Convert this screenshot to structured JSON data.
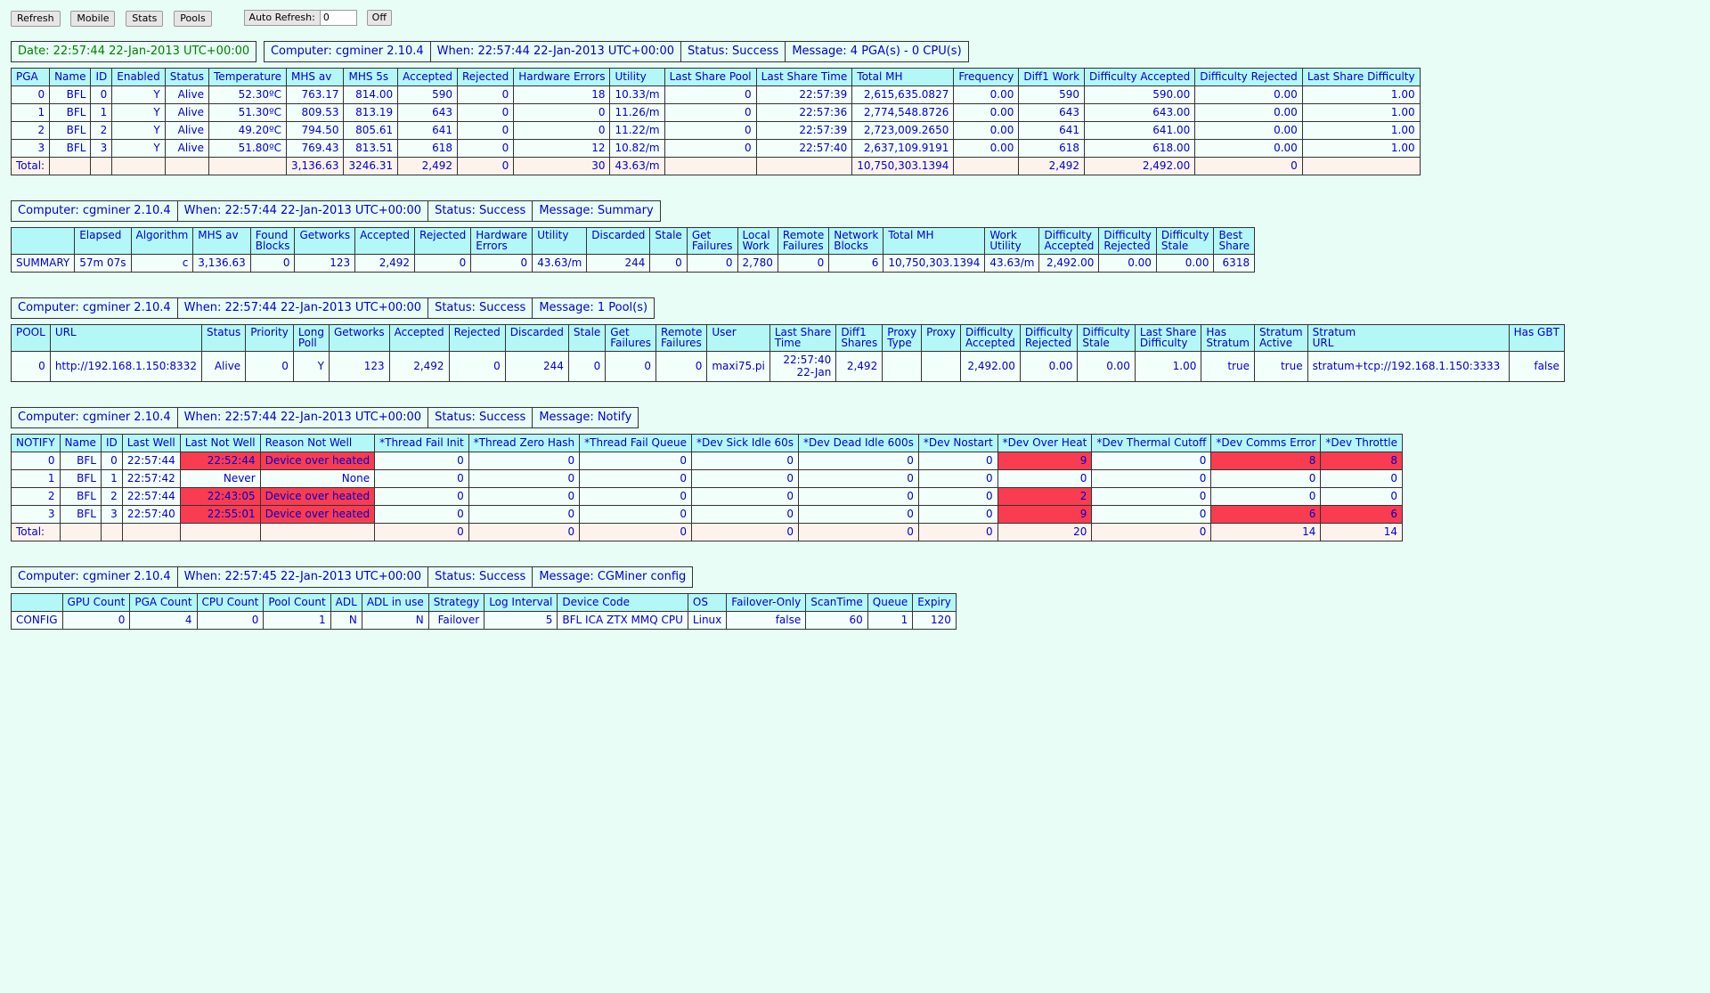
{
  "toolbar": {
    "refresh_label": "Refresh",
    "mobile_label": "Mobile",
    "stats_label": "Stats",
    "pools_label": "Pools",
    "auto_refresh_label": "Auto Refresh:",
    "auto_refresh_value": "0",
    "off_label": "Off"
  },
  "date_line": "Date: 22:57:44 22-Jan-2013 UTC+00:00",
  "colors": {
    "page_bg": "#e8fdf5",
    "header_bg": "#b4f7f7",
    "cell_bg": "#f3fffb",
    "total_bg": "#fdf3ec",
    "error_bg": "#fa3c50",
    "text": "#0000cc",
    "date_text": "#008000",
    "border": "#333333"
  },
  "sections": {
    "pga": {
      "computer": "Computer: cgminer 2.10.4",
      "when": "When: 22:57:44 22-Jan-2013 UTC+00:00",
      "status": "Status: Success",
      "message": "Message: 4 PGA(s) - 0 CPU(s)",
      "headers": [
        "PGA",
        "Name",
        "ID",
        "Enabled",
        "Status",
        "Temperature",
        "MHS av",
        "MHS 5s",
        "Accepted",
        "Rejected",
        "Hardware Errors",
        "Utility",
        "Last Share Pool",
        "Last Share Time",
        "Total MH",
        "Frequency",
        "Diff1 Work",
        "Difficulty Accepted",
        "Difficulty Rejected",
        "Last Share Difficulty"
      ],
      "rows": [
        [
          "0",
          "BFL",
          "0",
          "Y",
          "Alive",
          "52.30ºC",
          "763.17",
          "814.00",
          "590",
          "0",
          "18",
          "10.33/m",
          "0",
          "22:57:39",
          "2,615,635.0827",
          "0.00",
          "590",
          "590.00",
          "0.00",
          "1.00"
        ],
        [
          "1",
          "BFL",
          "1",
          "Y",
          "Alive",
          "51.30ºC",
          "809.53",
          "813.19",
          "643",
          "0",
          "0",
          "11.26/m",
          "0",
          "22:57:36",
          "2,774,548.8726",
          "0.00",
          "643",
          "643.00",
          "0.00",
          "1.00"
        ],
        [
          "2",
          "BFL",
          "2",
          "Y",
          "Alive",
          "49.20ºC",
          "794.50",
          "805.61",
          "641",
          "0",
          "0",
          "11.22/m",
          "0",
          "22:57:39",
          "2,723,009.2650",
          "0.00",
          "641",
          "641.00",
          "0.00",
          "1.00"
        ],
        [
          "3",
          "BFL",
          "3",
          "Y",
          "Alive",
          "51.80ºC",
          "769.43",
          "813.51",
          "618",
          "0",
          "12",
          "10.82/m",
          "0",
          "22:57:40",
          "2,637,109.9191",
          "0.00",
          "618",
          "618.00",
          "0.00",
          "1.00"
        ]
      ],
      "total_row": [
        "Total:",
        "",
        "",
        "",
        "",
        "",
        "3,136.63",
        "3246.31",
        "2,492",
        "0",
        "30",
        "43.63/m",
        "",
        "",
        "10,750,303.1394",
        "",
        "2,492",
        "2,492.00",
        "0",
        ""
      ]
    },
    "summary": {
      "computer": "Computer: cgminer 2.10.4",
      "when": "When: 22:57:44 22-Jan-2013 UTC+00:00",
      "status": "Status: Success",
      "message": "Message: Summary",
      "headers": [
        "",
        "Elapsed",
        "Algorithm",
        "MHS av",
        "Found Blocks",
        "Getworks",
        "Accepted",
        "Rejected",
        "Hardware Errors",
        "Utility",
        "Discarded",
        "Stale",
        "Get Failures",
        "Local Work",
        "Remote Failures",
        "Network Blocks",
        "Total MH",
        "Work Utility",
        "Difficulty Accepted",
        "Difficulty Rejected",
        "Difficulty Stale",
        "Best Share"
      ],
      "rows": [
        [
          "SUMMARY",
          "57m 07s",
          "c",
          "3,136.63",
          "0",
          "123",
          "2,492",
          "0",
          "0",
          "43.63/m",
          "244",
          "0",
          "0",
          "2,780",
          "0",
          "6",
          "10,750,303.1394",
          "43.63/m",
          "2,492.00",
          "0.00",
          "0.00",
          "6318"
        ]
      ]
    },
    "pool": {
      "computer": "Computer: cgminer 2.10.4",
      "when": "When: 22:57:44 22-Jan-2013 UTC+00:00",
      "status": "Status: Success",
      "message": "Message: 1 Pool(s)",
      "headers": [
        "POOL",
        "URL",
        "Status",
        "Priority",
        "Long Poll",
        "Getworks",
        "Accepted",
        "Rejected",
        "Discarded",
        "Stale",
        "Get Failures",
        "Remote Failures",
        "User",
        "Last Share Time",
        "Diff1 Shares",
        "Proxy Type",
        "Proxy",
        "Difficulty Accepted",
        "Difficulty Rejected",
        "Difficulty Stale",
        "Last Share Difficulty",
        "Has Stratum",
        "Stratum Active",
        "Stratum URL",
        "Has GBT"
      ],
      "rows": [
        [
          "0",
          "http://192.168.1.150:8332",
          "Alive",
          "0",
          "Y",
          "123",
          "2,492",
          "0",
          "244",
          "0",
          "0",
          "0",
          "maxi75.pi",
          "22:57:40 22-Jan",
          "2,492",
          "",
          "",
          "2,492.00",
          "0.00",
          "0.00",
          "1.00",
          "true",
          "true",
          "stratum+tcp://192.168.1.150:3333",
          "false"
        ]
      ]
    },
    "notify": {
      "computer": "Computer: cgminer 2.10.4",
      "when": "When: 22:57:44 22-Jan-2013 UTC+00:00",
      "status": "Status: Success",
      "message": "Message: Notify",
      "headers": [
        "NOTIFY",
        "Name",
        "ID",
        "Last Well",
        "Last Not Well",
        "Reason Not Well",
        "*Thread Fail Init",
        "*Thread Zero Hash",
        "*Thread Fail Queue",
        "*Dev Sick Idle 60s",
        "*Dev Dead Idle 600s",
        "*Dev Nostart",
        "*Dev Over Heat",
        "*Dev Thermal Cutoff",
        "*Dev Comms Error",
        "*Dev Throttle"
      ],
      "rows": [
        {
          "cells": [
            "0",
            "BFL",
            "0",
            "22:57:44",
            "22:52:44",
            "Device over heated",
            "0",
            "0",
            "0",
            "0",
            "0",
            "0",
            "9",
            "0",
            "8",
            "8"
          ],
          "err": [
            4,
            5,
            12,
            14,
            15
          ]
        },
        {
          "cells": [
            "1",
            "BFL",
            "1",
            "22:57:42",
            "Never",
            "None",
            "0",
            "0",
            "0",
            "0",
            "0",
            "0",
            "0",
            "0",
            "0",
            "0"
          ],
          "err": []
        },
        {
          "cells": [
            "2",
            "BFL",
            "2",
            "22:57:44",
            "22:43:05",
            "Device over heated",
            "0",
            "0",
            "0",
            "0",
            "0",
            "0",
            "2",
            "0",
            "0",
            "0"
          ],
          "err": [
            4,
            5,
            12
          ]
        },
        {
          "cells": [
            "3",
            "BFL",
            "3",
            "22:57:40",
            "22:55:01",
            "Device over heated",
            "0",
            "0",
            "0",
            "0",
            "0",
            "0",
            "9",
            "0",
            "6",
            "6"
          ],
          "err": [
            4,
            5,
            12,
            14,
            15
          ]
        }
      ],
      "total_row": [
        "Total:",
        "",
        "",
        "",
        "",
        "",
        "0",
        "0",
        "0",
        "0",
        "0",
        "0",
        "20",
        "0",
        "14",
        "14"
      ]
    },
    "config": {
      "computer": "Computer: cgminer 2.10.4",
      "when": "When: 22:57:45 22-Jan-2013 UTC+00:00",
      "status": "Status: Success",
      "message": "Message: CGMiner config",
      "headers": [
        "",
        "GPU Count",
        "PGA Count",
        "CPU Count",
        "Pool Count",
        "ADL",
        "ADL in use",
        "Strategy",
        "Log Interval",
        "Device Code",
        "OS",
        "Failover-Only",
        "ScanTime",
        "Queue",
        "Expiry"
      ],
      "rows": [
        [
          "CONFIG",
          "0",
          "4",
          "0",
          "1",
          "N",
          "N",
          "Failover",
          "5",
          "BFL ICA ZTX MMQ CPU",
          "Linux",
          "false",
          "60",
          "1",
          "120"
        ]
      ]
    }
  }
}
